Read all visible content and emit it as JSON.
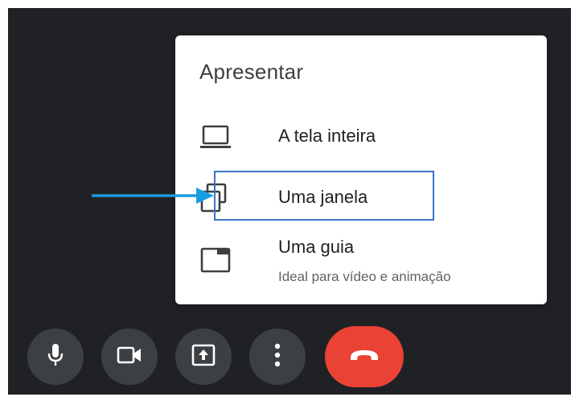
{
  "present_menu": {
    "title": "Apresentar",
    "items": [
      {
        "label": "A tela inteira",
        "icon": "laptop-icon"
      },
      {
        "label": "Uma janela",
        "icon": "window-icon"
      },
      {
        "label": "Uma guia",
        "subtitle": "Ideal para vídeo e animação",
        "icon": "tab-icon"
      }
    ]
  },
  "annotation": {
    "color": "#1a9be0",
    "highlight_color": "#3b73c8"
  },
  "controls": [
    {
      "icon": "mic-icon"
    },
    {
      "icon": "camera-icon"
    },
    {
      "icon": "present-screen-icon"
    },
    {
      "icon": "more-options-icon"
    },
    {
      "icon": "end-call-icon",
      "color": "#ea4335"
    }
  ],
  "colors": {
    "background": "#202124",
    "button": "#3c4043",
    "menu": "#ffffff"
  }
}
